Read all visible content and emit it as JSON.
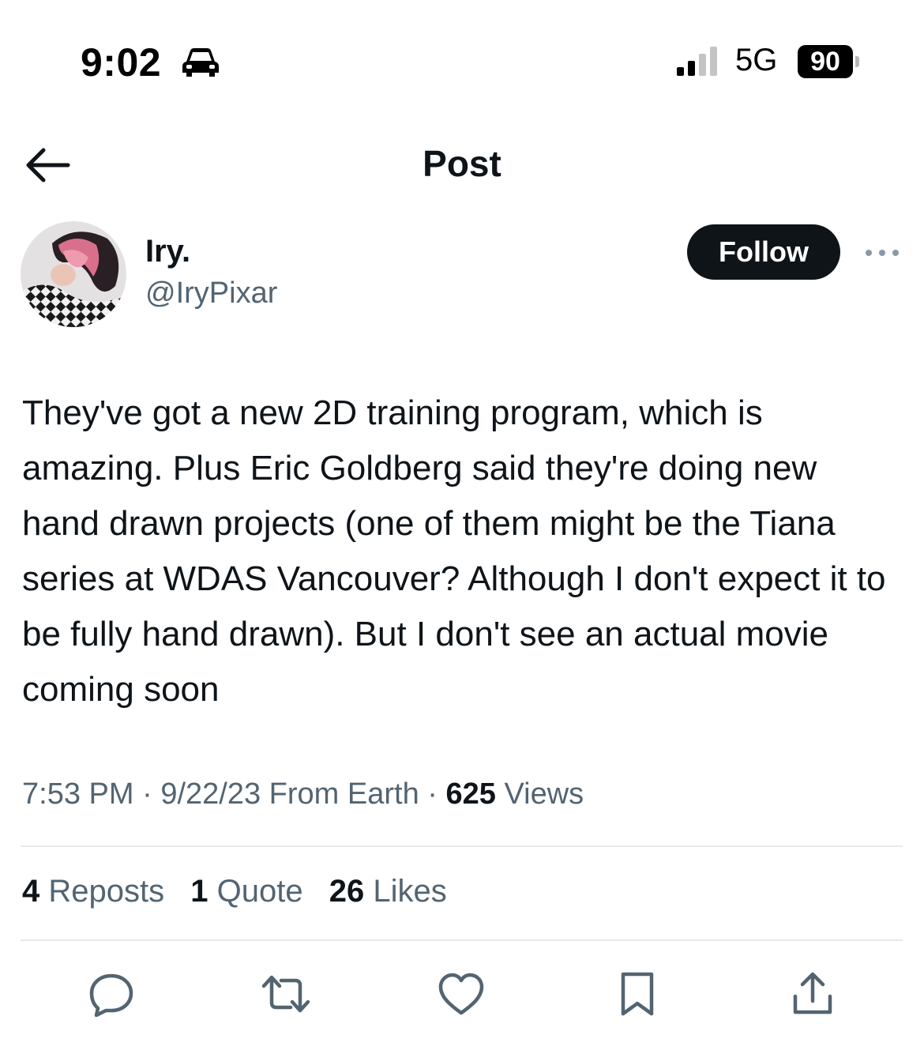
{
  "status_bar": {
    "time": "9:02",
    "network": "5G",
    "battery": "90"
  },
  "header": {
    "title": "Post"
  },
  "author": {
    "display_name": "Iry.",
    "handle": "@IryPixar",
    "follow_label": "Follow"
  },
  "post": {
    "text": "They've got a new 2D training program, which is amazing. Plus Eric Goldberg said they're doing new hand drawn projects (one of them might be the Tiana series at WDAS Vancouver? Although I don't expect it to be fully hand drawn). But I don't see an actual movie coming soon",
    "time": "7:53 PM",
    "date": "9/22/23",
    "location": "From Earth",
    "sep": "·",
    "views_count": "625",
    "views_label": "Views"
  },
  "stats": {
    "reposts_count": "4",
    "reposts_label": "Reposts",
    "quotes_count": "1",
    "quotes_label": "Quote",
    "likes_count": "26",
    "likes_label": "Likes"
  },
  "icons": [
    "car-icon",
    "signal-icon",
    "back-arrow-icon",
    "more-icon",
    "reply-icon",
    "repost-icon",
    "like-icon",
    "bookmark-icon",
    "share-icon"
  ]
}
